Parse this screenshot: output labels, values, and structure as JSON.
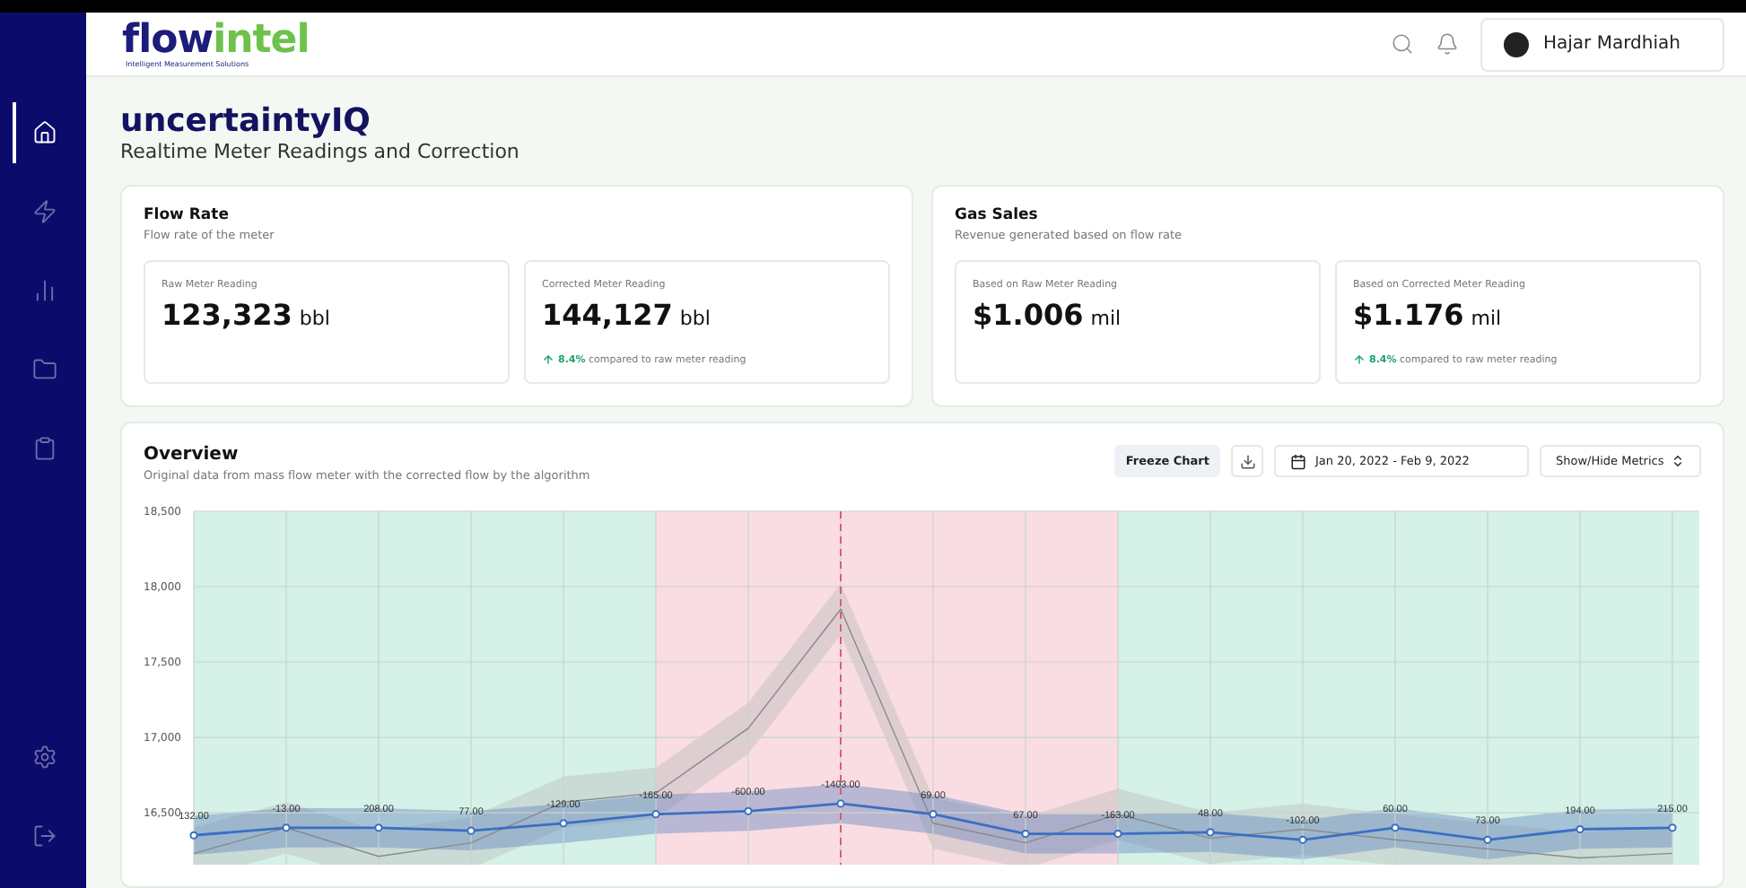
{
  "logo": {
    "brand_part_1": "flow",
    "brand_part_2": "intel",
    "tagline": "Intelligent Measurement Solutions"
  },
  "user": {
    "name": "Hajar Mardhiah"
  },
  "nav": [
    {
      "kind": "home",
      "selected": true
    },
    {
      "kind": "bolt",
      "selected": false
    },
    {
      "kind": "chart",
      "selected": false
    },
    {
      "kind": "folder",
      "selected": false
    },
    {
      "kind": "clipboard",
      "selected": false
    }
  ],
  "nav_bottom": [
    {
      "kind": "settings"
    },
    {
      "kind": "logout"
    }
  ],
  "page": {
    "title": "uncertaintyIQ",
    "subtitle": "Realtime Meter Readings and Correction"
  },
  "cards": [
    {
      "title": "Flow Rate",
      "subtitle": "Flow rate of the meter",
      "stats": [
        {
          "label": "Raw Meter Reading",
          "value": "123,323",
          "unit": "bbl"
        },
        {
          "label": "Corrected Meter Reading",
          "value": "144,127",
          "unit": "bbl",
          "delta": "8.4%",
          "delta_text": "compared to raw meter reading"
        }
      ]
    },
    {
      "title": "Gas Sales",
      "subtitle": "Revenue generated based on flow rate",
      "stats": [
        {
          "label": "Based on Raw Meter Reading",
          "value": "$1.006",
          "unit": "mil"
        },
        {
          "label": "Based on Corrected Meter Reading",
          "value": "$1.176",
          "unit": "mil",
          "delta": "8.4%",
          "delta_text": "compared to raw meter reading"
        }
      ]
    }
  ],
  "overview": {
    "title": "Overview",
    "subtitle": "Original data from mass flow meter with the corrected flow by the algorithm",
    "freeze_button": "Freeze Chart",
    "date_range": "Jan 20, 2022 - Feb 9, 2022",
    "metrics_button": "Show/Hide Metrics",
    "points": [
      {
        "anomaly": false,
        "marked": false
      },
      {
        "anomaly": false,
        "marked": false
      },
      {
        "anomaly": false,
        "marked": false
      },
      {
        "anomaly": false,
        "marked": false
      },
      {
        "anomaly": false,
        "marked": false
      },
      {
        "anomaly": true,
        "marked": false
      },
      {
        "anomaly": true,
        "marked": false
      },
      {
        "anomaly": true,
        "marked": true
      },
      {
        "anomaly": true,
        "marked": false
      },
      {
        "anomaly": true,
        "marked": false
      },
      {
        "anomaly": false,
        "marked": false
      },
      {
        "anomaly": false,
        "marked": false
      },
      {
        "anomaly": false,
        "marked": false
      },
      {
        "anomaly": false,
        "marked": false
      },
      {
        "anomaly": false,
        "marked": false
      },
      {
        "anomaly": false,
        "marked": false
      },
      {
        "anomaly": false,
        "marked": false
      }
    ],
    "chart_data": {
      "type": "line",
      "grid": true,
      "ylim": [
        16155,
        18500
      ],
      "yticks": [
        {
          "value": 16500,
          "label": "16,500"
        },
        {
          "value": 17000,
          "label": "17,000"
        },
        {
          "value": 17500,
          "label": "17,500"
        },
        {
          "value": 18000,
          "label": "18,000"
        },
        {
          "value": 18500,
          "label": "18,500"
        }
      ],
      "series": [
        {
          "color": "#8a8a8a",
          "values": [
            16230,
            16400,
            16210,
            16300,
            16570,
            16630,
            17060,
            17850,
            16430,
            16300,
            16490,
            16330,
            16390,
            16320,
            16260,
            16200,
            16230
          ]
        },
        {
          "color": "#3a6fc4",
          "marker": "o",
          "values": [
            16350,
            16400,
            16400,
            16380,
            16430,
            16490,
            16510,
            16560,
            16490,
            16360,
            16360,
            16370,
            16320,
            16400,
            16320,
            16390,
            16400
          ]
        }
      ],
      "value_labels": [
        "132.00",
        "-13.00",
        "208.00",
        "77.00",
        "-129.00",
        "-165.00",
        "-600.00",
        "-1403.00",
        "69.00",
        "67.00",
        "-163.00",
        "48.00",
        "-102.00",
        "60.00",
        "73.00",
        "194.00",
        "215.00"
      ]
    }
  }
}
